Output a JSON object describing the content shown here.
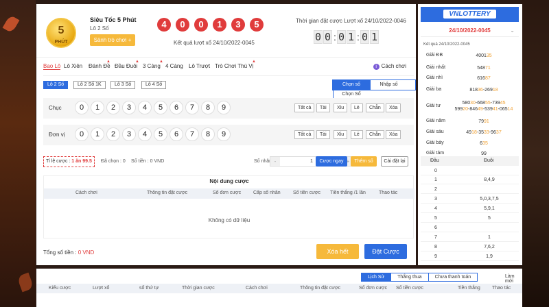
{
  "header": {
    "logo_number": "5",
    "logo_text": "PHÚT",
    "game_title": "Siêu Tốc 5 Phút",
    "game_subtitle": "Lô 2 Số",
    "hall_button": "Sảnh trò chơi",
    "result_balls": [
      "4",
      "0",
      "0",
      "1",
      "3",
      "5"
    ],
    "result_text": "Kết quả lượt xổ 24/10/2022-0045",
    "bet_time_label": "Thời gian đặt cược Lượt xổ 24/10/2022-0046",
    "timer": [
      "0",
      "0",
      "0",
      "1",
      "0",
      "1"
    ]
  },
  "tabs": [
    {
      "label": "Bao Lô",
      "active": true
    },
    {
      "label": "Lô Xiên"
    },
    {
      "label": "Đánh Đề"
    },
    {
      "label": "Đầu Đuôi"
    },
    {
      "label": "3 Càng"
    },
    {
      "label": "4 Càng"
    },
    {
      "label": "Lô Trượt"
    },
    {
      "label": "Trò Chơi Thú Vị"
    }
  ],
  "howto_label": "Cách chơi",
  "subtabs": [
    "Lô 2 Số",
    "Lô 2 Số 1K",
    "Lô 3 Số",
    "Lô 4 Số"
  ],
  "modes": [
    "Chọn số",
    "Nhập số",
    "Chọn Số Nhanh"
  ],
  "rows": [
    {
      "label": "Chục"
    },
    {
      "label": "Đơn vị"
    }
  ],
  "numbers": [
    "0",
    "1",
    "2",
    "3",
    "4",
    "5",
    "6",
    "7",
    "8",
    "9"
  ],
  "quick_buttons": [
    "Tất cả",
    "Tài",
    "Xỉu",
    "Lẻ",
    "Chẵn",
    "Xóa"
  ],
  "betbar": {
    "odds_label": "Tỉ lệ cược :",
    "odds_value": "1 ăn 99.5",
    "selected": "Đã chọn : 0",
    "money": "Số tiền : 0 VND",
    "multiplier_label": "Số nhân :",
    "multiplier_value": "1",
    "minus": "-",
    "plus": "+",
    "bet_now": "Cược ngay",
    "add_number": "Thêm số",
    "reset": "Cài đặt lại"
  },
  "content": {
    "title": "Nội dung cược",
    "headers": [
      "Cách chơi",
      "Thông tin đặt cược",
      "Số đơn cược",
      "Cấp số nhân",
      "Số tiền cược",
      "Tiền thắng /1 lần",
      "Thao tác"
    ],
    "empty": "Không có dữ liệu"
  },
  "total_label": "Tổng số tiền :",
  "total_value": "0 VND",
  "clear_all": "Xóa hết",
  "place_bet": "Đặt Cược",
  "side": {
    "logo": "VNLOTTERY",
    "date": "24/10/2022-0045",
    "chevron": "⌄",
    "result_label": "Kết quả 24/10/2022-0045",
    "prizes": [
      {
        "name": "Giải ĐB",
        "value": "400135"
      },
      {
        "name": "Giải nhất",
        "value": "54871"
      },
      {
        "name": "Giải nhì",
        "value": "61687"
      },
      {
        "name": "Giải ba",
        "value": "81836-26918"
      },
      {
        "name": "Giải tư",
        "value": "58030-66855-73945 59920-84649-53941-06514"
      },
      {
        "name": "Giải năm",
        "value": "7991"
      },
      {
        "name": "Giải sáu",
        "value": "4918-3533-9637"
      },
      {
        "name": "Giải bảy",
        "value": "635"
      },
      {
        "name": "Giải tám",
        "value": "99"
      }
    ],
    "dd_head": [
      "Đầu",
      "Đuôi"
    ],
    "dd_rows": [
      {
        "d": "0",
        "t": ""
      },
      {
        "d": "1",
        "t": "8,4,9"
      },
      {
        "d": "2",
        "t": ""
      },
      {
        "d": "3",
        "t": "5,0,3,7,5"
      },
      {
        "d": "4",
        "t": "5,9,1"
      },
      {
        "d": "5",
        "t": "5"
      },
      {
        "d": "6",
        "t": ""
      },
      {
        "d": "7",
        "t": "1"
      },
      {
        "d": "8",
        "t": "7,6,2"
      },
      {
        "d": "9",
        "t": "1,9"
      }
    ]
  },
  "bottom": {
    "tabs": [
      "Lịch Sử",
      "Thắng thua",
      "Chưa thanh toán"
    ],
    "refresh": "Làm mới",
    "headers": [
      "Kiểu cược",
      "Lượt xổ",
      "số thứ tự",
      "Thời gian cược",
      "Cách chơi",
      "Thông tin đặt cược",
      "Số đơn cược",
      "Số tiền cược",
      "Tiền thắng",
      "Thao tác"
    ]
  }
}
